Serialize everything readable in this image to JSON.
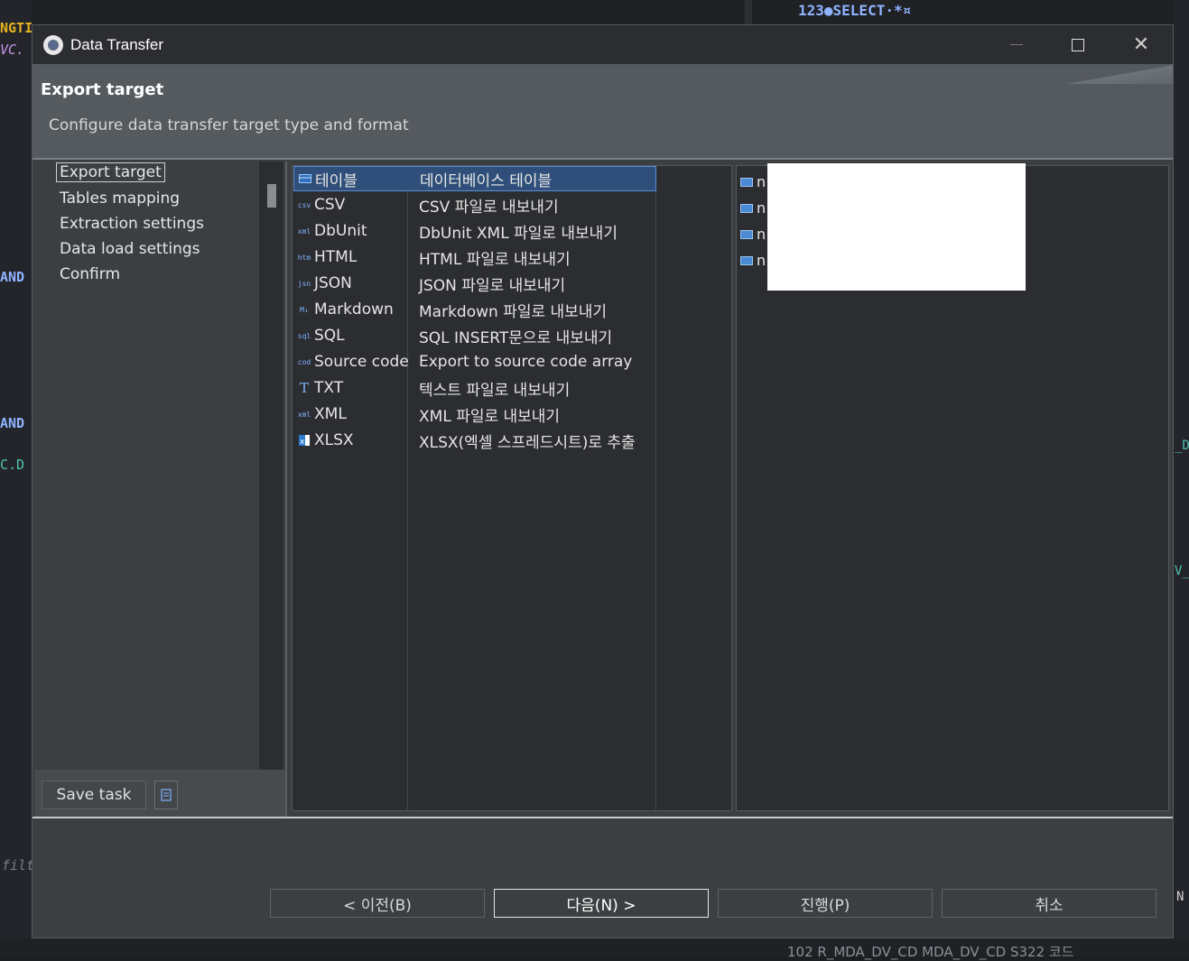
{
  "background": {
    "top_right_code": "123●SELECT·*¤",
    "left_fragments": [
      "NGTI",
      "VC.",
      "AND",
      "AND",
      "C.D"
    ],
    "right_fragments": [
      "_DV",
      "V_",
      "N"
    ],
    "left_filter": "filte",
    "bottom_status": "102  R_MDA_DV_CD    MDA_DV_CD   S322        코드"
  },
  "window": {
    "title": "Data Transfer",
    "icon": "dbeaver-app-icon",
    "controls": {
      "minimize": "minimize-icon",
      "maximize": "maximize-icon",
      "close": "✕"
    }
  },
  "header": {
    "title": "Export target",
    "description": "Configure data transfer target type and format"
  },
  "nav": {
    "items": [
      {
        "label": "Export target",
        "selected": true
      },
      {
        "label": "Tables mapping",
        "selected": false
      },
      {
        "label": "Extraction settings",
        "selected": false
      },
      {
        "label": "Data load settings",
        "selected": false
      },
      {
        "label": "Confirm",
        "selected": false
      }
    ],
    "save_task_label": "Save task",
    "save_icon": "save-task-icon"
  },
  "types": [
    {
      "name": "테이블",
      "description": "데이터베이스 테이블",
      "icon": "table-icon",
      "selected": true
    },
    {
      "name": "CSV",
      "description": "CSV 파일로 내보내기",
      "icon": "csv-icon"
    },
    {
      "name": "DbUnit",
      "description": "DbUnit XML 파일로 내보내기",
      "icon": "dbunit-icon"
    },
    {
      "name": "HTML",
      "description": "HTML 파일로 내보내기",
      "icon": "html-icon"
    },
    {
      "name": "JSON",
      "description": "JSON 파일로 내보내기",
      "icon": "json-icon"
    },
    {
      "name": "Markdown",
      "description": "Markdown 파일로 내보내기",
      "icon": "markdown-icon"
    },
    {
      "name": "SQL",
      "description": "SQL INSERT문으로 내보내기",
      "icon": "sql-icon"
    },
    {
      "name": "Source code",
      "description": "Export to source code array",
      "icon": "code-icon"
    },
    {
      "name": "TXT",
      "description": "텍스트 파일로 내보내기",
      "icon": "txt-icon"
    },
    {
      "name": "XML",
      "description": "XML 파일로 내보내기",
      "icon": "xml-icon"
    },
    {
      "name": "XLSX",
      "description": "XLSX(엑셀 스프레드시트)로 추출",
      "icon": "xlsx-icon"
    }
  ],
  "targets": [
    {
      "label": "n"
    },
    {
      "label": "n"
    },
    {
      "label": "n"
    },
    {
      "label": "n"
    }
  ],
  "footer": {
    "back_label": "< 이전(B)",
    "next_label": "다음(N) >",
    "proceed_label": "진행(P)",
    "cancel_label": "취소"
  }
}
